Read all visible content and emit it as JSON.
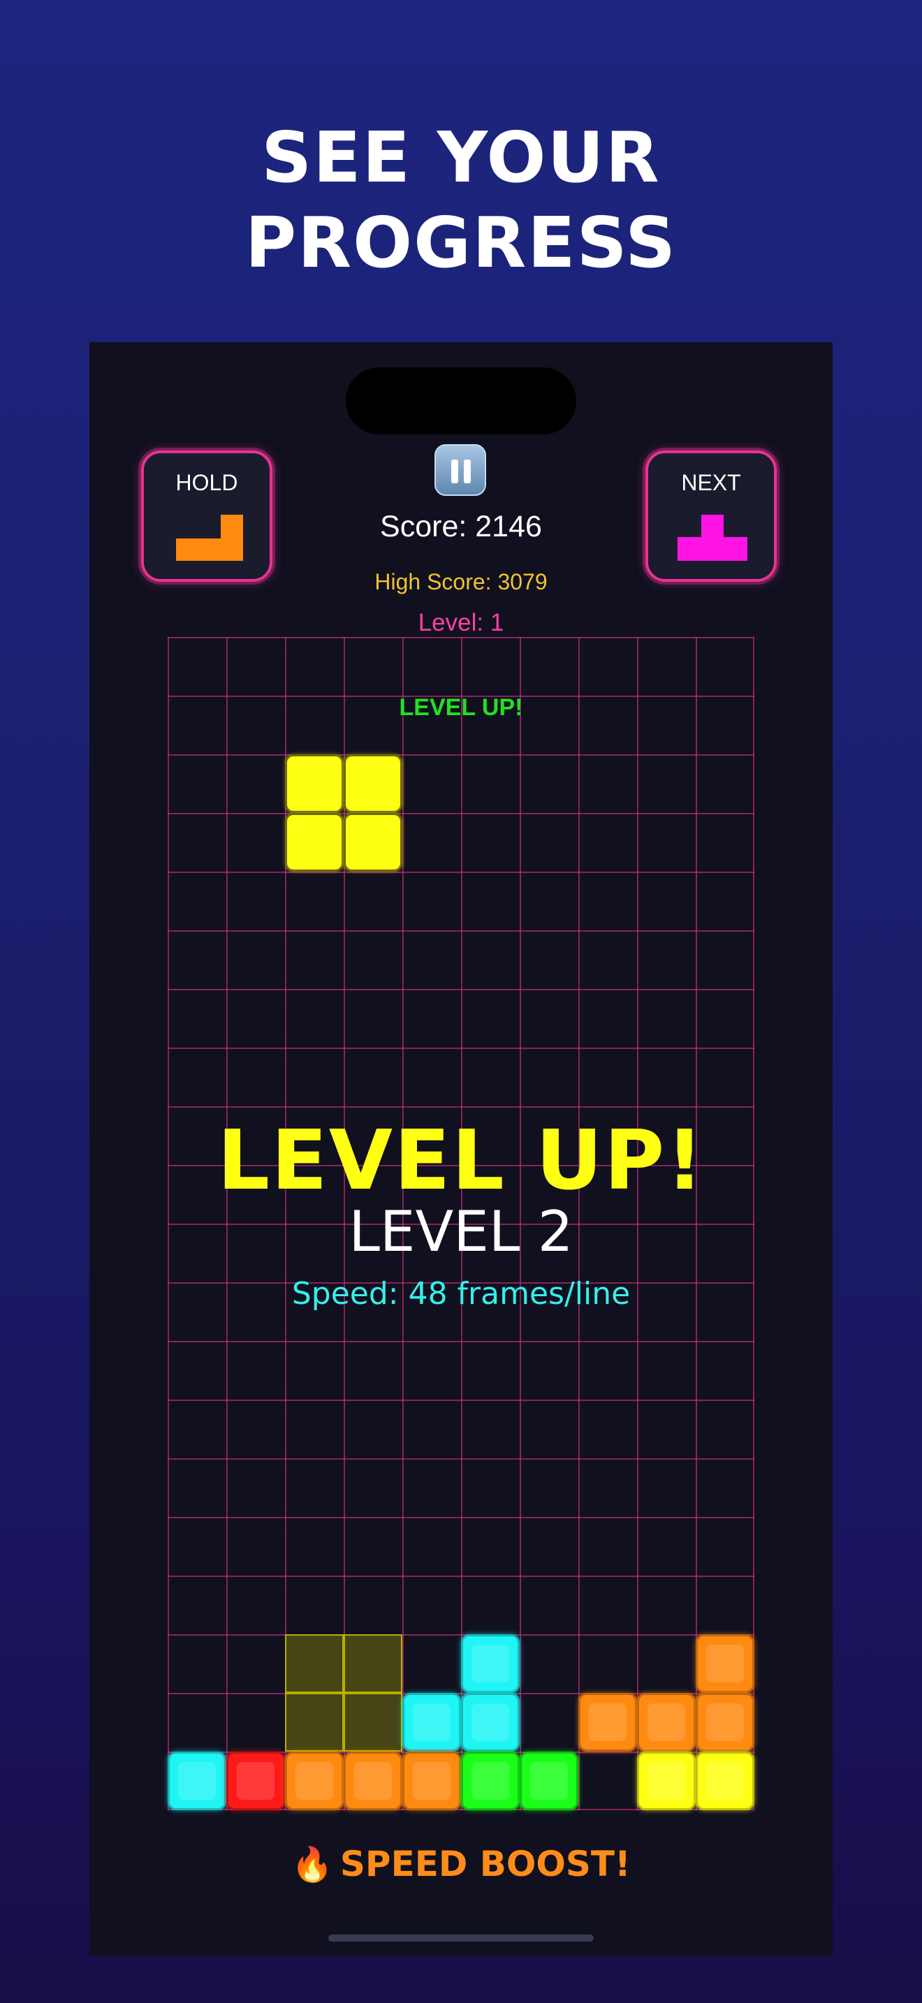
{
  "promo": {
    "headline_line1": "SEE YOUR",
    "headline_line2": "PROGRESS"
  },
  "hud": {
    "hold_label": "HOLD",
    "next_label": "NEXT",
    "score_text": "Score: 2146",
    "high_score_text": "High Score: 3079",
    "level_text": "Level: 1",
    "pause_icon": "pause-icon",
    "hold_piece": {
      "shape": "J",
      "color": "#ff8a12"
    },
    "next_piece": {
      "shape": "T",
      "color": "#ff14e6"
    }
  },
  "board": {
    "columns": 10,
    "rows": 20,
    "grid_color": "#c82d78",
    "small_banner": "LEVEL UP!",
    "big_banner": "LEVEL UP!",
    "level_banner": "LEVEL 2",
    "speed_banner": "Speed: 48 frames/line",
    "active_piece": {
      "shape": "O",
      "color": "#ffff14",
      "cells": [
        [
          2,
          2
        ],
        [
          3,
          2
        ],
        [
          2,
          3
        ],
        [
          3,
          3
        ]
      ]
    },
    "ghost_cells": [
      [
        2,
        17
      ],
      [
        3,
        17
      ],
      [
        2,
        18
      ],
      [
        3,
        18
      ]
    ],
    "locked_cells": [
      {
        "c": 5,
        "r": 17,
        "color": "#1ff5f5"
      },
      {
        "c": 9,
        "r": 17,
        "color": "#ff8a12"
      },
      {
        "c": 4,
        "r": 18,
        "color": "#1ff5f5"
      },
      {
        "c": 5,
        "r": 18,
        "color": "#1ff5f5"
      },
      {
        "c": 7,
        "r": 18,
        "color": "#ff8a12"
      },
      {
        "c": 8,
        "r": 18,
        "color": "#ff8a12"
      },
      {
        "c": 9,
        "r": 18,
        "color": "#ff8a12"
      },
      {
        "c": 0,
        "r": 19,
        "color": "#1ff5f5"
      },
      {
        "c": 1,
        "r": 19,
        "color": "#ff1a1a"
      },
      {
        "c": 2,
        "r": 19,
        "color": "#ff8a12"
      },
      {
        "c": 3,
        "r": 19,
        "color": "#ff8a12"
      },
      {
        "c": 4,
        "r": 19,
        "color": "#ff8a12"
      },
      {
        "c": 5,
        "r": 19,
        "color": "#1aff1a"
      },
      {
        "c": 6,
        "r": 19,
        "color": "#1aff1a"
      },
      {
        "c": 8,
        "r": 19,
        "color": "#ffff14"
      },
      {
        "c": 9,
        "r": 19,
        "color": "#ffff14"
      }
    ]
  },
  "footer": {
    "boost_icon": "fire-icon",
    "boost_text": "SPEED BOOST!"
  }
}
